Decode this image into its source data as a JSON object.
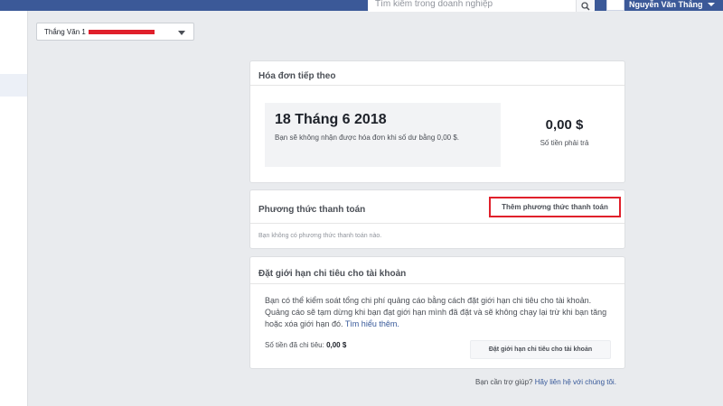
{
  "header": {
    "search_placeholder": "Tìm kiếm trong doanh nghiệp",
    "search_icon": "search-icon",
    "user_name": "Nguyễn Văn Thắng"
  },
  "account_selector": {
    "label": "Thắng Văn 1"
  },
  "next_bill": {
    "title": "Hóa đơn tiếp theo",
    "date": "18 Tháng 6 2018",
    "description": "Bạn sẽ không nhận được hóa đơn khi số dư bằng 0,00 $.",
    "amount": "0,00 $",
    "amount_label": "Số tiền phải trả"
  },
  "payment_methods": {
    "title": "Phương thức thanh toán",
    "add_button": "Thêm phương thức thanh toán",
    "empty_text": "Bạn không có phương thức thanh toán nào."
  },
  "spending_limit": {
    "title": "Đặt giới hạn chi tiêu cho tài khoản",
    "description": "Bạn có thể kiểm soát tổng chi phí quảng cáo bằng cách đặt giới hạn chi tiêu cho tài khoản. Quảng cáo sẽ tạm dừng khi bạn đạt giới hạn mình đã đặt và sẽ không chạy lại trừ khi bạn tăng hoặc xóa giới hạn đó.",
    "learn_more": "Tìm hiểu thêm.",
    "spent_label": "Số tiền đã chi tiêu:",
    "spent_value": "0,00 $",
    "set_limit_button": "Đặt giới hạn chi tiêu cho tài khoản"
  },
  "footer": {
    "help_prefix": "Bạn cần trợ giúp?",
    "help_link": "Hãy liên hệ với chúng tôi."
  },
  "colors": {
    "topbar": "#3b5998",
    "page_bg": "#e9ebee",
    "highlight_red": "#e0202b",
    "link": "#365899"
  }
}
